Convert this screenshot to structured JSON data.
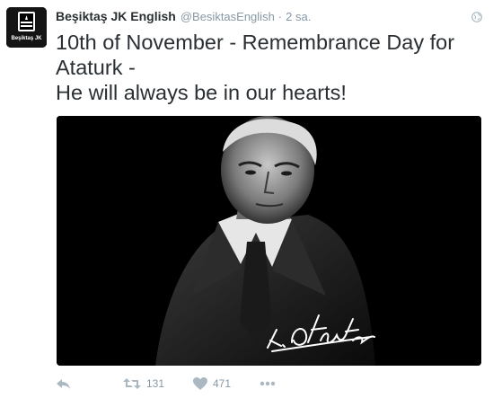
{
  "tweet": {
    "name": "Beşiktaş JK English",
    "handle": "@BesiktasEnglish",
    "separator": "·",
    "time": "2 sa.",
    "avatar_label": "Beşiktaş JK",
    "text_lines": [
      "10th of November - Remembrance Day for",
      "Ataturk -",
      "He will always be in our hearts!"
    ],
    "media": {
      "description_icon": "portrait-photo",
      "signature": "K. Atatürk"
    },
    "actions": {
      "reply_icon": "reply-icon",
      "retweet_icon": "retweet-icon",
      "retweet_count": "131",
      "like_icon": "heart-icon",
      "like_count": "471",
      "more_icon": "more-icon"
    },
    "colors": {
      "text": "#292f33",
      "muted": "#8899a6",
      "icon": "#aab8c2",
      "media_bg": "#000000"
    }
  }
}
